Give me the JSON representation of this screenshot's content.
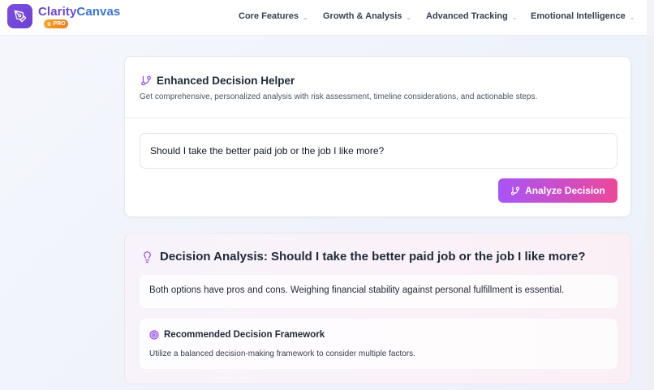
{
  "brand": {
    "name_part1": "Clarity",
    "name_part2": "Canvas",
    "badge": "PRO",
    "accent": "#6d3fd6"
  },
  "nav": {
    "items": [
      {
        "label": "Core Features",
        "icon": "chevron-down-icon"
      },
      {
        "label": "Growth & Analysis",
        "icon": "chevron-down-icon"
      },
      {
        "label": "Advanced Tracking",
        "icon": "chevron-down-icon"
      },
      {
        "label": "Emotional Intelligence",
        "icon": "chevron-down-icon"
      }
    ]
  },
  "helper": {
    "icon": "git-branch-icon",
    "title": "Enhanced Decision Helper",
    "subtitle": "Get comprehensive, personalized analysis with risk assessment, timeline considerations, and actionable steps.",
    "input_value": "Should I take the better paid job or the job I like more?",
    "button_label": "Analyze Decision",
    "button_gradient": [
      "#a855f7",
      "#ec4899"
    ]
  },
  "analysis": {
    "icon": "lightbulb-icon",
    "title": "Decision Analysis: Should I take the better paid job or the job I like more?",
    "summary": "Both options have pros and cons. Weighing financial stability against personal fulfillment is essential.",
    "framework": {
      "icon": "target-icon",
      "title": "Recommended Decision Framework",
      "text": "Utilize a balanced decision-making framework to consider multiple factors."
    }
  }
}
